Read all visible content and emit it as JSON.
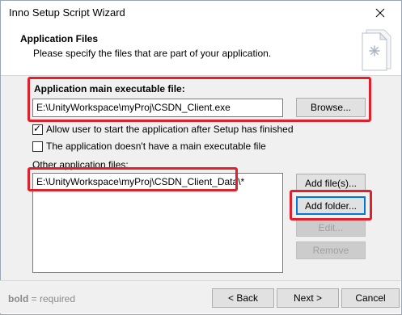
{
  "window": {
    "title": "Inno Setup Script Wizard",
    "close_glyph": "✕"
  },
  "header": {
    "title": "Application Files",
    "subtitle": "Please specify the files that are part of your application.",
    "image_icon": "wizard-document-icon"
  },
  "main_exe": {
    "label": "Application main executable file:",
    "value": "E:\\UnityWorkspace\\myProj\\CSDN_Client.exe",
    "browse_label": "Browse..."
  },
  "options": {
    "allow_start": {
      "label": "Allow user to start the application after Setup has finished",
      "checked": true
    },
    "no_main_exe": {
      "label": "The application doesn't have a main executable file",
      "checked": false
    }
  },
  "other_files": {
    "label": "Other application files:",
    "items": [
      "E:\\UnityWorkspace\\myProj\\CSDN_Client_Data\\*"
    ],
    "add_files_label": "Add file(s)...",
    "add_folder_label": "Add folder...",
    "edit_label": "Edit...",
    "remove_label": "Remove"
  },
  "footer": {
    "note_bold": "bold",
    "note_rest": " = required",
    "back_label": "< Back",
    "next_label": "Next >",
    "cancel_label": "Cancel"
  },
  "colors": {
    "highlight": "#e0202a",
    "focus": "#0078d7"
  }
}
